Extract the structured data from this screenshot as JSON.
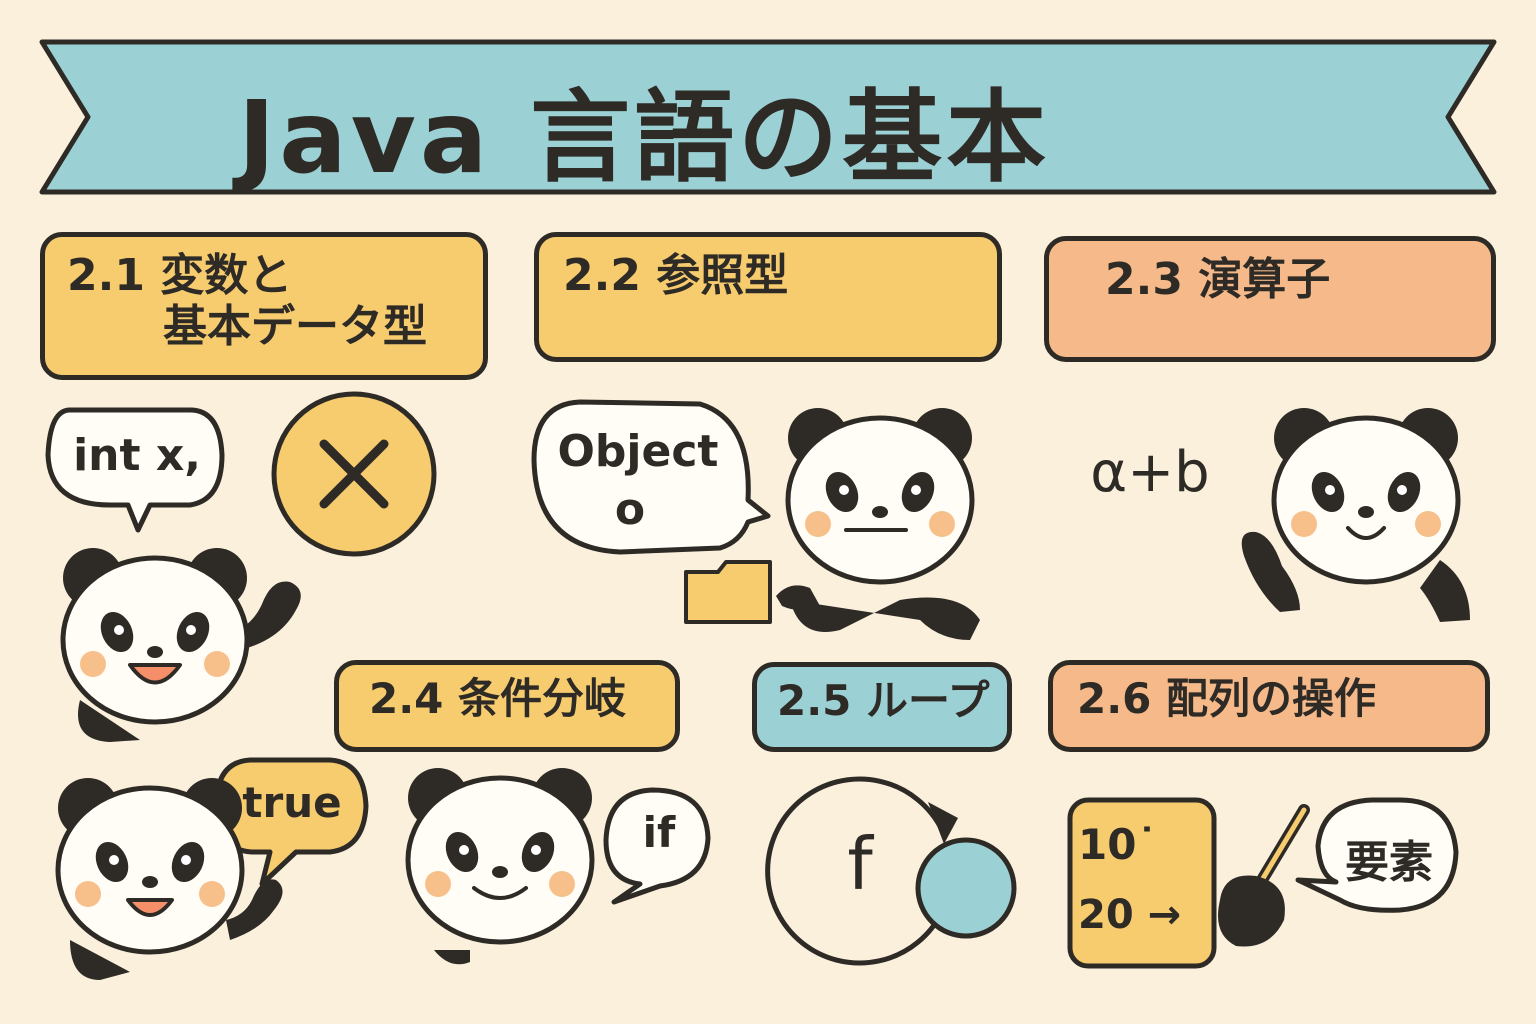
{
  "banner": {
    "title": "Java 言語の基本"
  },
  "sections": [
    {
      "id": "2.1",
      "label_line1": "2.1 変数と",
      "label_line2": "基本データ型",
      "color": "#f6cc6f"
    },
    {
      "id": "2.2",
      "label": "2.2 参照型",
      "color": "#f6cc6f"
    },
    {
      "id": "2.3",
      "label": "2.3 演算子",
      "color": "#f5b98a"
    },
    {
      "id": "2.4",
      "label": "2.4 条件分岐",
      "color": "#f6cc6f"
    },
    {
      "id": "2.5",
      "label": "2.5 ループ",
      "color": "#9bd1d5"
    },
    {
      "id": "2.6",
      "label": "2.6 配列の操作",
      "color": "#f5b98a"
    }
  ],
  "illustrations": {
    "variables_bubble": "int x,",
    "close_circle_glyph": "✕",
    "object_bubble_line1": "Object",
    "object_bubble_line2": "o",
    "operator_expression": "α+b",
    "true_bubble": "true",
    "if_bubble": "if",
    "loop_function": "f",
    "array_line1": "10˙",
    "array_line2": "20 →",
    "element_bubble": "要素"
  },
  "colors": {
    "background": "#fbf0dc",
    "banner": "#9bd1d5",
    "yellow": "#f6cc6f",
    "orange": "#f5b98a",
    "blue": "#9bd1d5",
    "outline": "#2e2a26",
    "blush": "#f7c08a"
  },
  "icons": [
    "panda-icon",
    "close-icon",
    "folder-icon",
    "loop-arrow-icon",
    "pointer-stick-icon"
  ]
}
